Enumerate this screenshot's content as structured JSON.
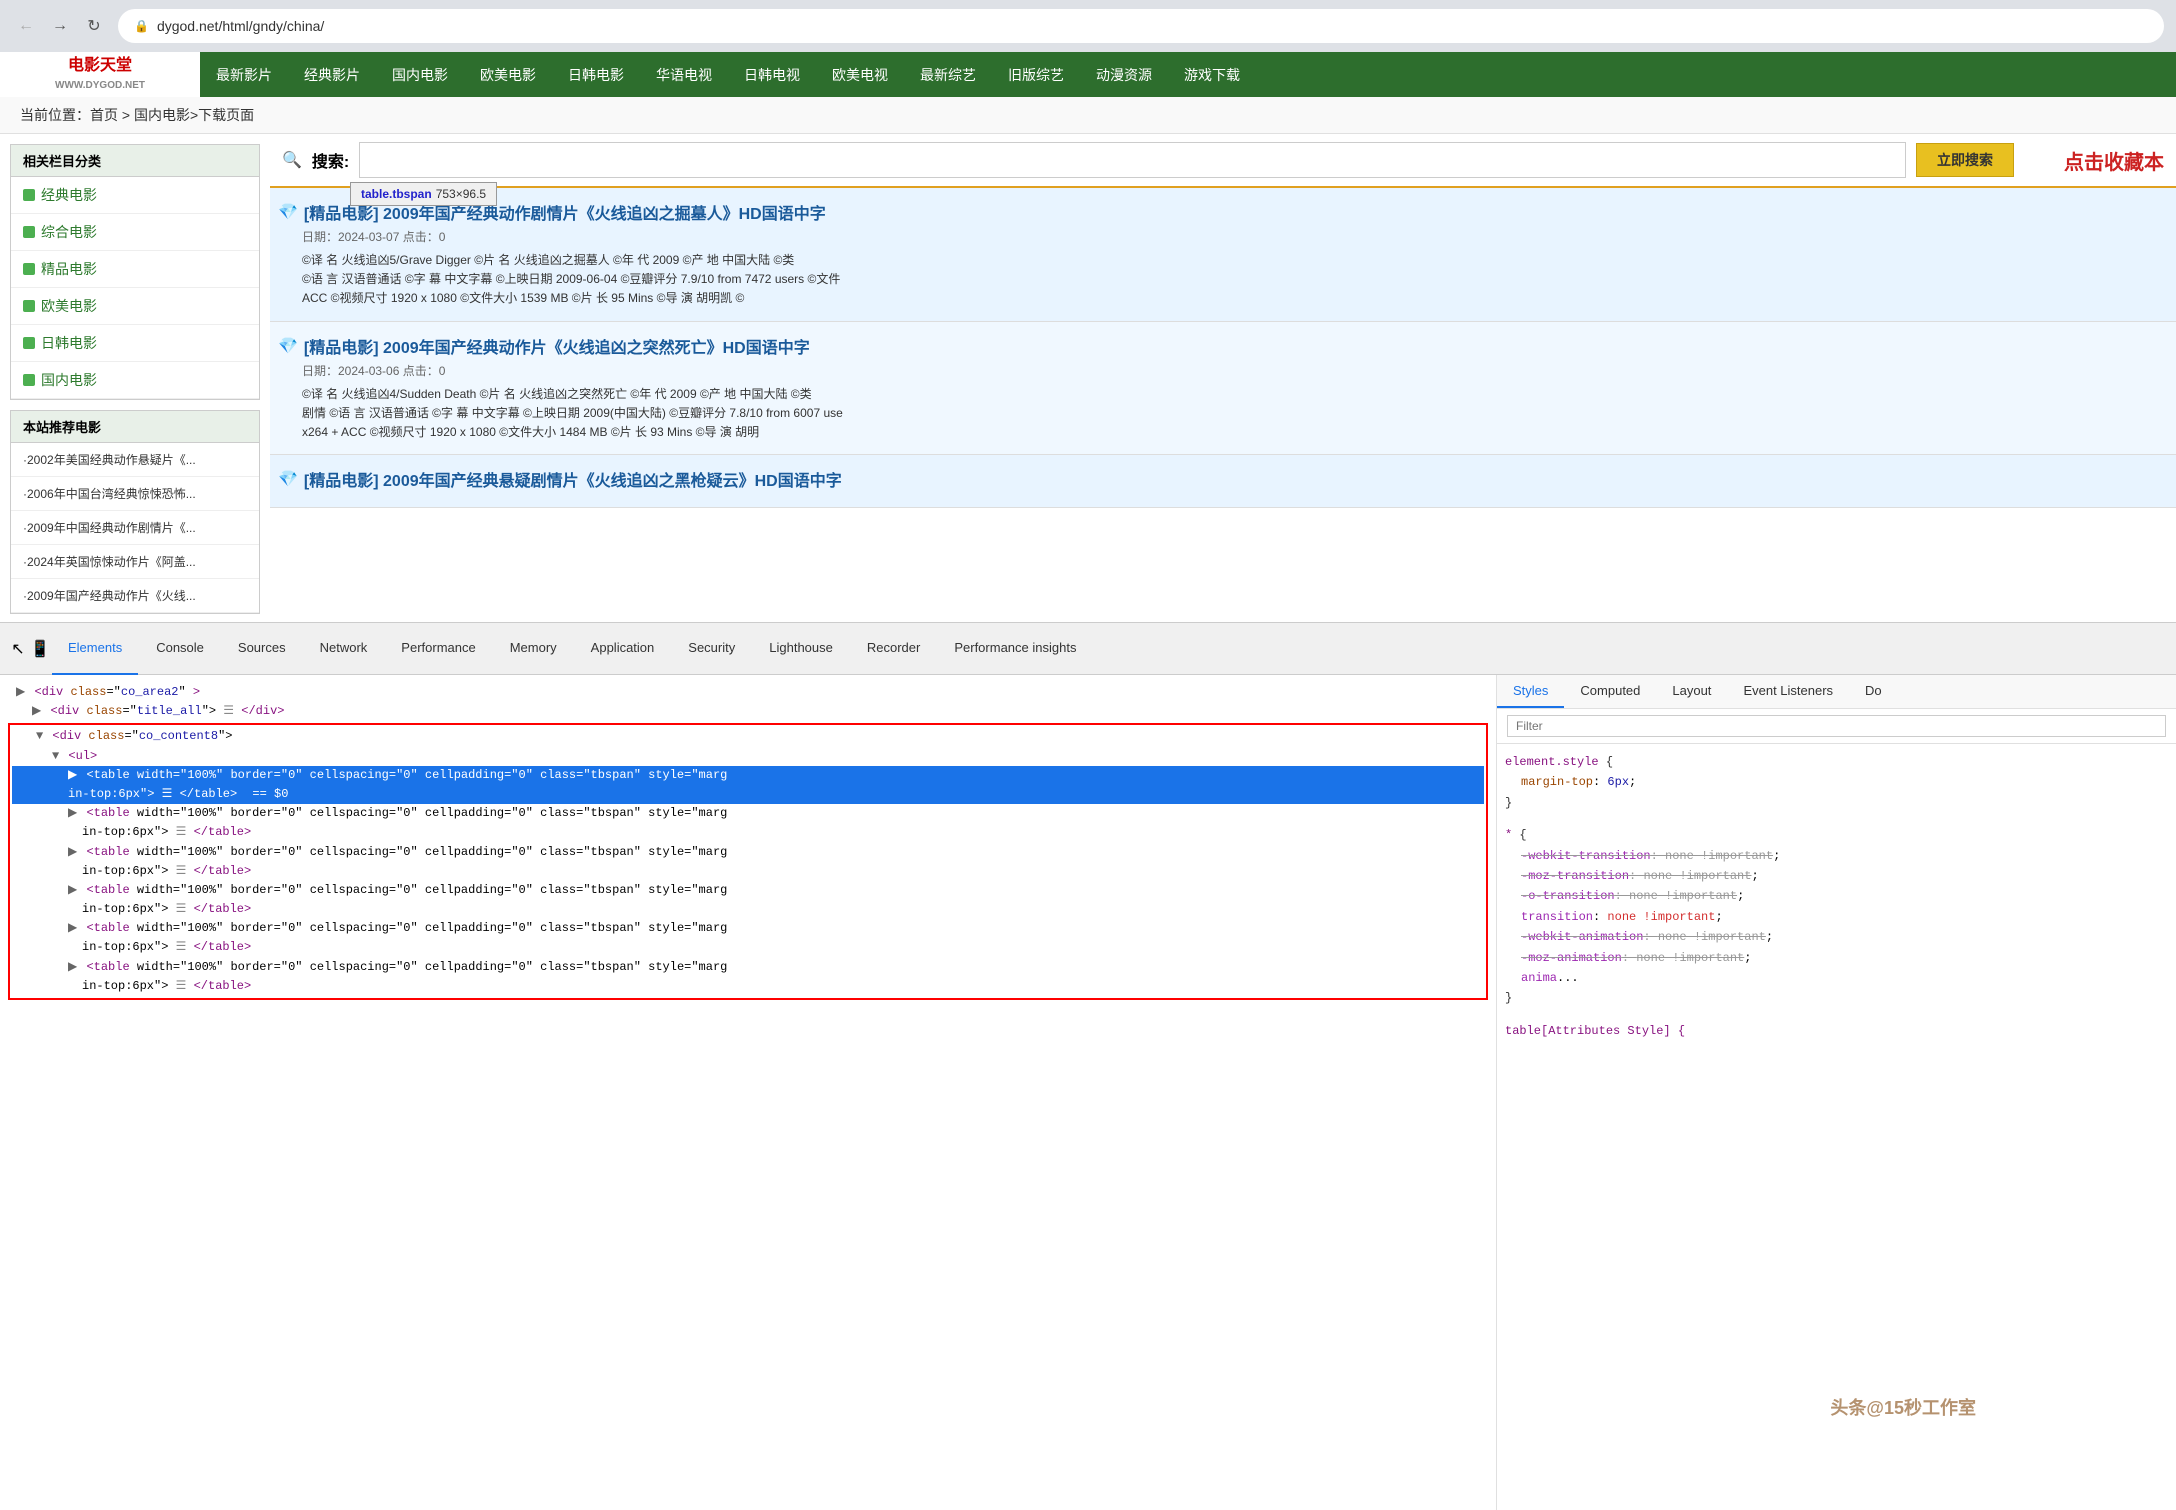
{
  "browser": {
    "back_btn": "←",
    "forward_btn": "→",
    "refresh_btn": "↻",
    "url": "dygod.net/html/gndy/china/",
    "lock_icon": "🔒"
  },
  "site": {
    "logo_text": "电影天堂\nWWW.DYGOD.NET",
    "nav_items": [
      "最新影片",
      "经典影片",
      "国内电影",
      "欧美电影",
      "日韩电影",
      "华语电视",
      "日韩电视",
      "欧美电视",
      "最新综艺",
      "旧版综艺",
      "动漫资源",
      "游戏下载"
    ],
    "breadcrumb": "当前位置：首页 > 国内电影>下载页面",
    "sidebar_title": "相关栏目分类",
    "sidebar_items": [
      "经典电影",
      "综合电影",
      "精品电影",
      "欧美电影",
      "日韩电影",
      "国内电影"
    ],
    "recommended_title": "本站推荐电影",
    "recommended_items": [
      "·2002年美国经典动作悬疑片《...",
      "·2006年中国台湾经典惊悚恐怖...",
      "·2009年中国经典动作剧情片《...",
      "·2024年英国惊悚动作片《阿盖...",
      "·2009年国产经典动作片《火线..."
    ],
    "search_label": "搜索:",
    "search_btn": "立即搜索",
    "bookmark_btn": "点击收藏本",
    "tooltip_element": "table.tbspan",
    "tooltip_size": "753×96.5",
    "movies": [
      {
        "title": "[精品电影] 2009年国产经典动作剧情片《火线追凶之掘墓人》HD国语中字",
        "date": "日期：2024-03-07 点击：0",
        "info_line1": "©译    名  火线追凶5/Grave Digger  ©片    名  火线追凶之掘墓人  ©年    代  2009  ©产    地  中国大陆  ©类",
        "info_line2": "©语    言  汉语普通话  ©字    幕  中文字幕  ©上映日期  2009-06-04  ©豆瓣评分   7.9/10 from 7472 users  ©文件",
        "info_line3": "ACC  ©视频尺寸   1920 x 1080  ©文件大小   1539 MB  ©片    长   95 Mins  ©导    演  胡明凯  ©"
      },
      {
        "title": "[精品电影] 2009年国产经典动作片《火线追凶之突然死亡》HD国语中字",
        "date": "日期：2024-03-06 点击：0",
        "info_line1": "©译    名  火线追凶4/Sudden Death  ©片    名  火线追凶之突然死亡  ©年    代  2009  ©产    地  中国大陆  ©类",
        "info_line2": "剧情  ©语    言  汉语普通话  ©字    幕  中文字幕  ©上映日期   2009(中国大陆)  ©豆瓣评分   7.8/10 from 6007 use",
        "info_line3": "x264 + ACC  ©视频尺寸   1920 x 1080  ©文件大小   1484 MB  ©片    长   93 Mins  ©导    演  胡明"
      },
      {
        "title": "[精品电影] 2009年国产经典悬疑剧情片《火线追凶之黑枪疑云》HD国语中字",
        "date": "",
        "info_line1": "",
        "info_line2": "",
        "info_line3": ""
      }
    ]
  },
  "devtools": {
    "toolbar_icons": [
      "cursor",
      "mobile",
      "elements",
      "console",
      "sources",
      "network",
      "performance",
      "memory",
      "application",
      "security",
      "lighthouse",
      "recorder",
      "performance_insights"
    ],
    "tabs": [
      "Elements",
      "Console",
      "Sources",
      "Network",
      "Performance",
      "Memory",
      "Application",
      "Security",
      "Lighthouse",
      "Recorder",
      "Performance insights"
    ],
    "active_tab": "Elements",
    "html_lines": [
      "<div class=\"co_area2\">",
      "  <div class=\"title_all\">  </div>",
      "  <div class=\"co_content8\">",
      "    <ul>",
      "      <table width=\"100%\" border=\"0\" cellspacing=\"0\" cellpadding=\"0\" class=\"tbspan\" style=\"marg",
      "      in-top:6px\">  </table>  == $0",
      "      <table width=\"100%\" border=\"0\" cellspacing=\"0\" cellpadding=\"0\" class=\"tbspan\" style=\"marg",
      "      in-top:6px\">  </table>",
      "      <table width=\"100%\" border=\"0\" cellspacing=\"0\" cellpadding=\"0\" class=\"tbspan\" style=\"marg",
      "      in-top:6px\">  </table>",
      "      <table width=\"100%\" border=\"0\" cellspacing=\"0\" cellpadding=\"0\" class=\"tbspan\" style=\"marg",
      "      in-top:6px\">  </table>",
      "      <table width=\"100%\" border=\"0\" cellspacing=\"0\" cellpadding=\"0\" class=\"tbspan\" style=\"marg",
      "      in-top:6px\">  </table>",
      "      <table width=\"100%\" border=\"0\" cellspacing=\"0\" cellpadding=\"0\" class=\"tbspan\" style=\"marg",
      "      in-top:6px\">  </table>"
    ],
    "css_tabs": [
      "Styles",
      "Computed",
      "Layout",
      "Event Listeners",
      "Do"
    ],
    "active_css_tab": "Styles",
    "css_filter_placeholder": "Filter",
    "css_rules": [
      {
        "selector": "element.style {",
        "properties": [
          {
            "prop": "margin-top",
            "val": "6px",
            "strikethrough": false
          }
        ]
      },
      {
        "selector": "* {",
        "properties": [
          {
            "prop": "-webkit-transition",
            "val": "none !important",
            "strikethrough": true
          },
          {
            "prop": "-moz-transition",
            "val": "none !important",
            "strikethrough": true
          },
          {
            "prop": "-o-transition",
            "val": "none !important",
            "strikethrough": true
          },
          {
            "prop": "transition",
            "val": "none !important",
            "strikethrough": false
          },
          {
            "prop": "-webkit-animation",
            "val": "none !important",
            "strikethrough": true
          },
          {
            "prop": "-moz-animation",
            "val": "none !important",
            "strikethrough": true
          },
          {
            "prop": "anima",
            "val": "...",
            "strikethrough": false
          }
        ]
      }
    ],
    "attributes_style_label": "table[Attributes Style] {"
  },
  "watermark": "头条@15秒工作室"
}
